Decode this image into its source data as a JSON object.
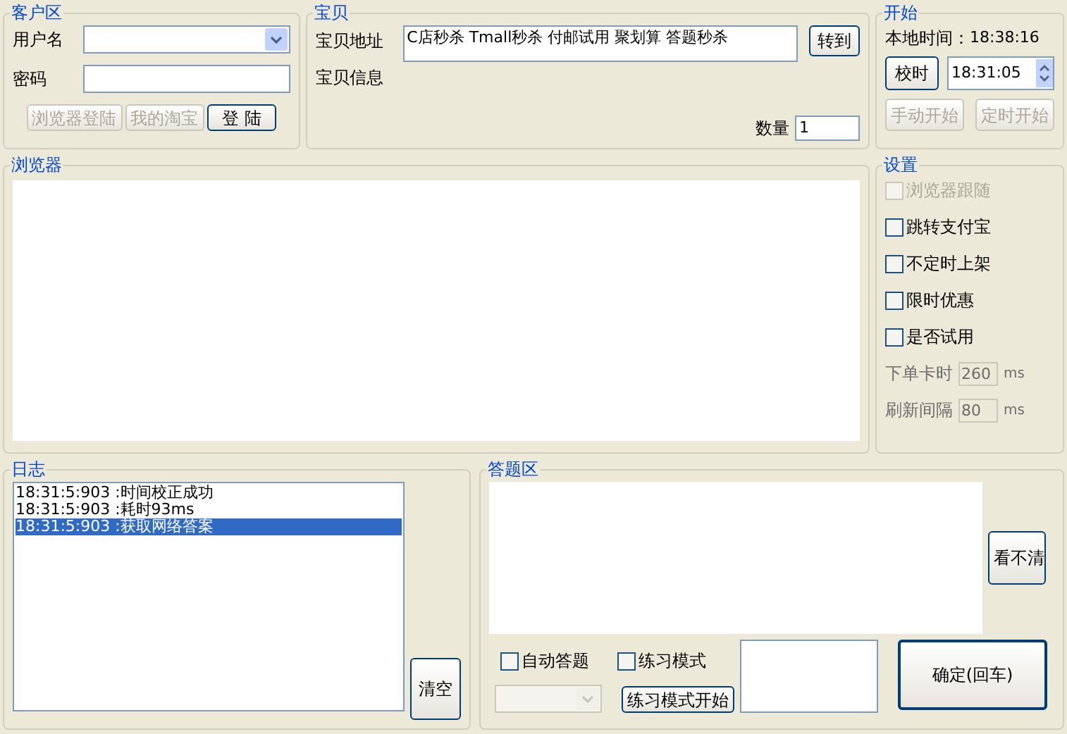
{
  "customer": {
    "title": "客户区",
    "username_label": "用户名",
    "password_label": "密码",
    "buttons": [
      {
        "label": "浏览器登陆",
        "disabled": true
      },
      {
        "label": "我的淘宝",
        "disabled": true
      },
      {
        "label": "登 陆",
        "disabled": false
      }
    ]
  },
  "item": {
    "title": "宝贝",
    "address_label": "宝贝地址",
    "address_value": "C店秒杀 Tmall秒杀 付邮试用 聚划算 答题秒杀",
    "goto_button": "转到",
    "info_label": "宝贝信息",
    "quantity_label": "数量",
    "quantity_value": "1"
  },
  "start": {
    "title": "开始",
    "local_time_label": "本地时间：",
    "local_time": "18:38:16",
    "sync_button": "校时",
    "time_value": "18:31:05",
    "buttons": [
      {
        "label": "手动开始",
        "disabled": true
      },
      {
        "label": "定时开始",
        "disabled": true
      }
    ]
  },
  "browser": {
    "title": "浏览器"
  },
  "settings": {
    "title": "设置",
    "options": [
      {
        "label": "浏览器跟随",
        "checked": false,
        "disabled": true
      },
      {
        "label": "跳转支付宝",
        "checked": false,
        "disabled": false
      },
      {
        "label": "不定时上架",
        "checked": false,
        "disabled": false
      },
      {
        "label": "限时优惠",
        "checked": false,
        "disabled": false
      },
      {
        "label": "是否试用",
        "checked": false,
        "disabled": false
      }
    ],
    "fields": [
      {
        "label": "下单卡时",
        "value": "260",
        "unit": "ms"
      },
      {
        "label": "刷新间隔",
        "value": "80",
        "unit": "ms"
      }
    ]
  },
  "log": {
    "title": "日志",
    "entries": [
      {
        "time": "18:31:5:903",
        "message": ":时间校正成功",
        "selected": false
      },
      {
        "time": "18:31:5:903",
        "message": ":耗时93ms",
        "selected": false
      },
      {
        "time": "18:31:5:903",
        "message": ":获取网络答案",
        "selected": true
      }
    ],
    "clear_button": "清空"
  },
  "answer": {
    "title": "答题区",
    "unclear_button": "看不清",
    "checks": [
      {
        "label": "自动答题",
        "checked": false
      },
      {
        "label": "练习模式",
        "checked": false
      }
    ],
    "practice_button": "练习模式开始",
    "confirm_button": "确定(回车)"
  }
}
